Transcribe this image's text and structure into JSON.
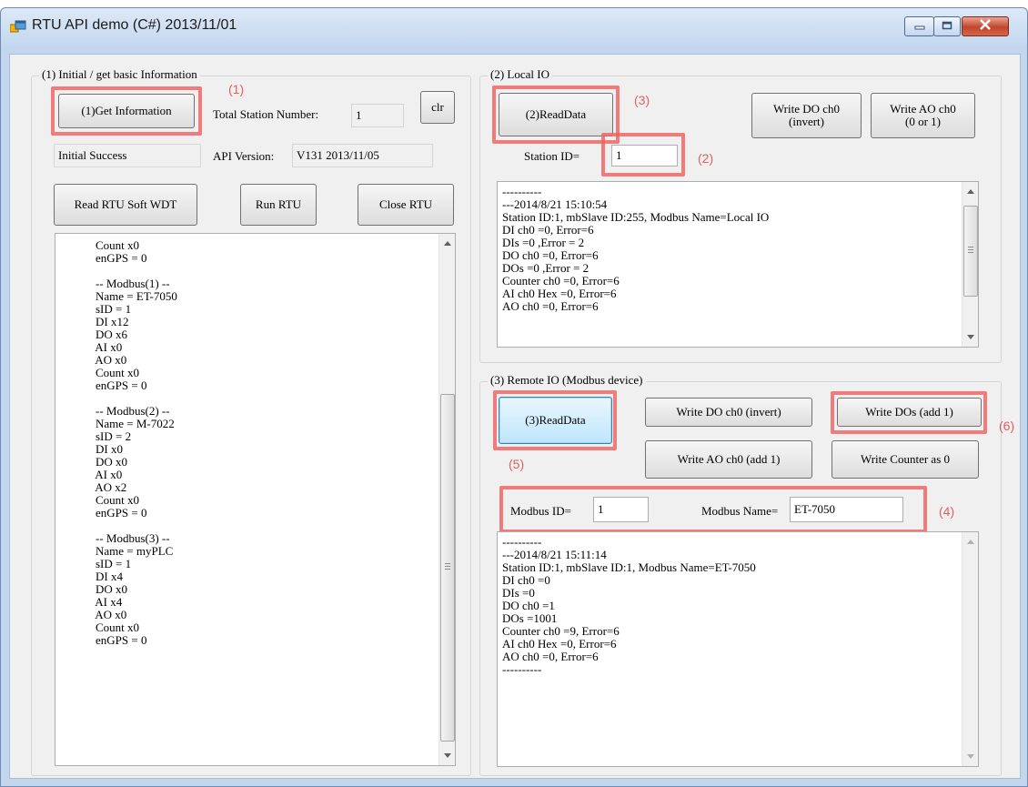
{
  "window": {
    "title": "RTU API demo (C#) 2013/11/01"
  },
  "group1": {
    "legend": "(1) Initial / get basic Information",
    "get_info_button": "(1)Get Information",
    "annotation": "(1)",
    "total_station_label": "Total Station Number:",
    "total_station_value": "1",
    "clr_button": "clr",
    "status": "Initial Success",
    "api_version_label": "API Version:",
    "api_version_value": "V131 2013/11/05",
    "read_wdt_button": "Read RTU Soft WDT",
    "run_button": "Run RTU",
    "close_button": "Close RTU",
    "log": "            Count x0\n            enGPS = 0\n\n            -- Modbus(1) --\n            Name = ET-7050\n            sID = 1\n            DI x12\n            DO x6\n            AI x0\n            AO x0\n            Count x0\n            enGPS = 0\n\n            -- Modbus(2) --\n            Name = M-7022\n            sID = 2\n            DI x0\n            DO x0\n            AI x0\n            AO x2\n            Count x0\n            enGPS = 0\n\n            -- Modbus(3) --\n            Name = myPLC\n            sID = 1\n            DI x4\n            DO x0\n            AI x4\n            AO x0\n            Count x0\n            enGPS = 0"
  },
  "group2": {
    "legend": "(2) Local IO",
    "read_button": "(2)ReadData",
    "annotation_read": "(3)",
    "write_do_button": "Write DO ch0\n(invert)",
    "write_ao_button": "Write AO ch0\n(0 or 1)",
    "station_label": "Station ID=",
    "station_value": "1",
    "annotation_station": "(2)",
    "log": "----------\n---2014/8/21 15:10:54\nStation ID:1, mbSlave ID:255, Modbus Name=Local IO\nDI ch0 =0, Error=6\nDIs =0 ,Error = 2\nDO ch0 =0, Error=6\nDOs =0 ,Error = 2\nCounter ch0 =0, Error=6\nAI ch0 Hex =0, Error=6\nAO ch0 =0, Error=6"
  },
  "group3": {
    "legend": "(3) Remote IO (Modbus device)",
    "read_button": "(3)ReadData",
    "annotation_read": "(5)",
    "write_do_button": "Write DO ch0 (invert)",
    "write_dos_button": "Write DOs (add 1)",
    "annotation_dos": "(6)",
    "write_ao_button": "Write AO ch0 (add 1)",
    "write_counter_button": "Write Counter as 0",
    "modbus_id_label": "Modbus ID=",
    "modbus_id_value": "1",
    "modbus_name_label": "Modbus Name=",
    "modbus_name_value": "ET-7050",
    "annotation_modbus": "(4)",
    "log": "----------\n---2014/8/21 15:11:14\nStation ID:1, mbSlave ID:1, Modbus Name=ET-7050\nDI ch0 =0\nDIs =0\nDO ch0 =1\nDOs =1001\nCounter ch0 =9, Error=6\nAI ch0 Hex =0, Error=6\nAO ch0 =0, Error=6\n----------"
  },
  "icons": {
    "app": "app-window-icon",
    "minimize": "minimize-icon",
    "maximize": "maximize-icon",
    "close": "close-icon"
  }
}
